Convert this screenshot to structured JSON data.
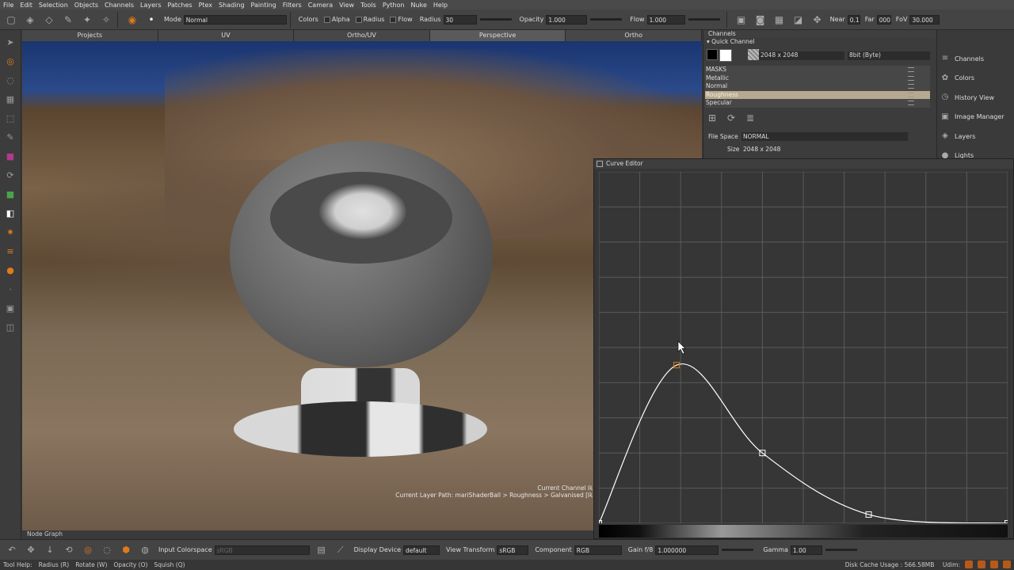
{
  "menubar": [
    "File",
    "Edit",
    "Selection",
    "Objects",
    "Channels",
    "Layers",
    "Patches",
    "Ptex",
    "Shading",
    "Painting",
    "Filters",
    "Camera",
    "View",
    "Tools",
    "Python",
    "Nuke",
    "Help"
  ],
  "toolbar": {
    "mode_label": "Mode",
    "mode_value": "Normal",
    "colors_label": "Colors",
    "alpha_label": "Alpha",
    "radius_check_label": "Radius",
    "flow_check_label": "Flow",
    "radius_label": "Radius",
    "radius_value": "30",
    "opacity_label": "Opacity",
    "opacity_value": "1.000",
    "flow_label": "Flow",
    "flow_value": "1.000",
    "near_label": "Near",
    "near_value": "0.1",
    "far_label": "Far",
    "far_value": "000",
    "fov_label": "FoV",
    "fov_value": "30.000"
  },
  "view_tabs": [
    "Projects",
    "UV",
    "Ortho/UV",
    "Perspective",
    "Ortho"
  ],
  "active_tab": "Perspective",
  "viewport": {
    "info_line1": "Current Channel ℝ",
    "info_line2": "Current Layer Path: mariShaderBall > Roughness > Galvanised [ℝ"
  },
  "node_graph_label": "Node Graph",
  "bottom_bar": {
    "input_colorspace_label": "Input Colorspace",
    "input_colorspace_value": "sRGB",
    "display_device_label": "Display Device",
    "display_device_value": "default",
    "view_transform_label": "View Transform",
    "view_transform_value": "sRGB",
    "component_label": "Component",
    "component_value": "RGB",
    "gain_label": "Gain f/8",
    "gain_value": "1.000000",
    "gamma_label": "Gamma",
    "gamma_value": "1.00"
  },
  "statusbar": {
    "tool_help": "Tool Help:",
    "radius": "Radius (R)",
    "rotate": "Rotate (W)",
    "opacity": "Opacity (O)",
    "squish": "Squish (Q)",
    "disk_cache": "Disk Cache Usage : 566.58MB",
    "udim": "Udim:"
  },
  "channels_panel": {
    "title": "Channels",
    "quick_channel_label": "Quick Channel",
    "size_value": "2048 x 2048",
    "depth_value": "8bit (Byte)",
    "channels": [
      "MASKS",
      "Metallic",
      "Normal",
      "Roughness",
      "Specular"
    ],
    "selected_channel": "Roughness",
    "file_space_label": "File Space",
    "file_space_value": "NORMAL",
    "size_label": "Size",
    "size_prop_value": "2048 x 2048"
  },
  "right_dock": {
    "items": [
      "Channels",
      "Colors",
      "History View",
      "Image Manager",
      "Layers",
      "Lights"
    ]
  },
  "curve_editor": {
    "title": "Curve Editor"
  },
  "chart_data": {
    "type": "line",
    "title": "",
    "grid": true,
    "xlim": [
      0,
      1
    ],
    "ylim": [
      0,
      1
    ],
    "control_points": [
      {
        "x": 0.0,
        "y": 0.0
      },
      {
        "x": 0.19,
        "y": 0.45
      },
      {
        "x": 0.4,
        "y": 0.2
      },
      {
        "x": 0.66,
        "y": 0.025
      },
      {
        "x": 1.0,
        "y": 0.0
      }
    ]
  },
  "colors": {
    "accent": "#e07b1a",
    "selection": "#b7a98f",
    "curve": "#ffffff",
    "grid": "#5a5a5a"
  }
}
